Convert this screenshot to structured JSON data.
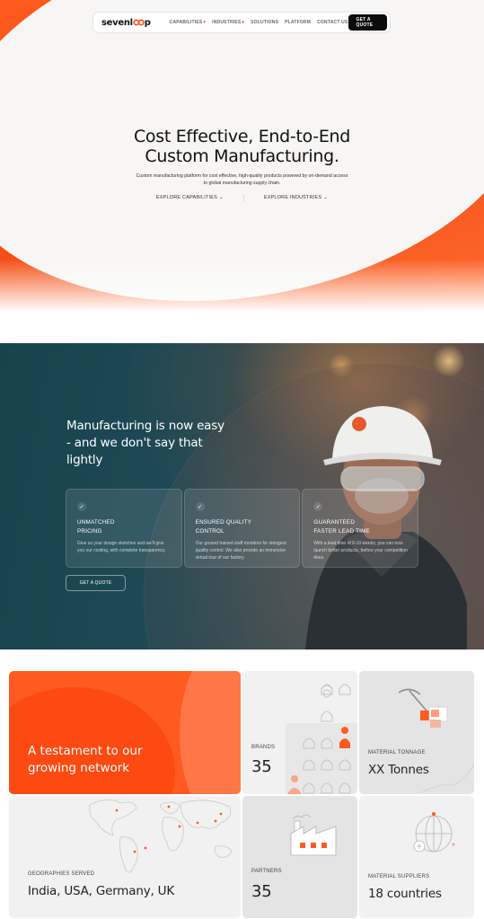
{
  "nav": {
    "logo_prefix": "sevenl",
    "logo_suffix": "p",
    "links": [
      {
        "label": "CAPABILITIES",
        "has_dropdown": true
      },
      {
        "label": "INDUSTRIES",
        "has_dropdown": true
      },
      {
        "label": "SOLUTIONS",
        "has_dropdown": false
      },
      {
        "label": "PLATFORM",
        "has_dropdown": false
      },
      {
        "label": "CONTACT US",
        "has_dropdown": false
      }
    ],
    "quote_label": "GET A QUOTE"
  },
  "hero": {
    "title_line1": "Cost Effective, End-to-End",
    "title_line2": "Custom Manufacturing.",
    "subtitle": "Custom manufacturing platform for cost effective, high-quality products powered by on-demand access to global manufacturing supply chain.",
    "cta_capabilities": "EXPLORE CAPABILITIES",
    "cta_industries": "EXPLORE INDUSTRIES"
  },
  "manufacturing": {
    "title": "Manufacturing is now easy - and we don't say that lightly",
    "features": [
      {
        "title_line1": "UNMATCHED",
        "title_line2": "PRICING",
        "description": "Give us your design sketches and we'll give you our costing, with complete transparency."
      },
      {
        "title_line1": "ENSURED QUALITY",
        "title_line2": "CONTROL",
        "description": "Our ground trained staff monitors for stringent quality control. We also provide an immersive virtual tour of our factory."
      },
      {
        "title_line1": "GUARANTEED",
        "title_line2": "FASTER LEAD TIME",
        "description": "With a lead time of 8-10 weeks, you can now launch better products, before your competition does."
      }
    ],
    "button_label": "GET A QUOTE"
  },
  "network": {
    "title": "A testament to our growing network",
    "brands": {
      "label": "BRANDS",
      "value": "35"
    },
    "tonnage": {
      "label": "MATERIAL TONNAGE",
      "value": "XX Tonnes"
    },
    "geographies": {
      "label": "GEOGRAPHIES SERVED",
      "value": "India, USA, Germany, UK"
    },
    "partners": {
      "label": "PARTNERS",
      "value": "35"
    },
    "suppliers": {
      "label": "MATERIAL SUPPLIERS",
      "value": "18 countries"
    }
  },
  "colors": {
    "accent": "#ff5a1f",
    "dark_section": "#1f4651",
    "tile_light": "#f1f1f1",
    "tile_mid": "#e4e4e4"
  },
  "icons": [
    "chevron-down-icon",
    "check-icon",
    "people-icon",
    "pickaxe-icon",
    "world-map-icon",
    "factory-icon",
    "globe-icon"
  ]
}
